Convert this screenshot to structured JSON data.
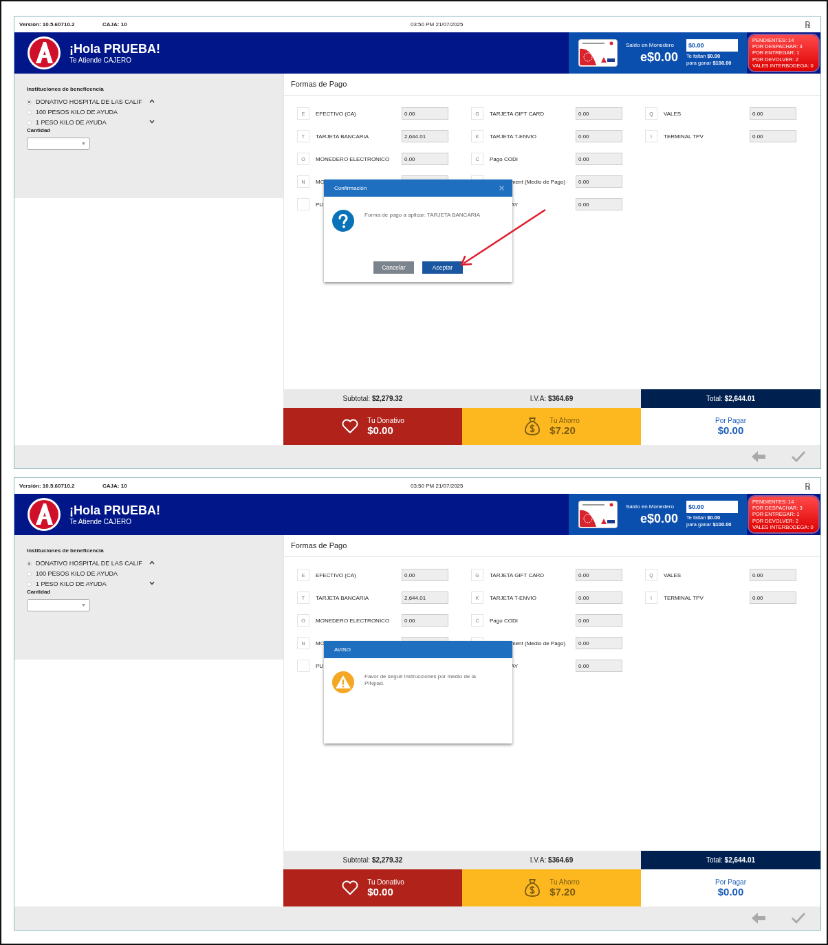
{
  "screens": [
    {
      "top_bar": {
        "version_label": "Versión:",
        "version": "10.5.60710.2",
        "register_label": "CAJA:",
        "register": "10",
        "datetime": "03:50 PM 21/07/2025",
        "rx_symbol": "℞"
      },
      "header": {
        "greeting": "¡Hola PRUEBA!",
        "cashier": "Te Atiende CAJERO",
        "wallet_label": "Saldo en Monedero",
        "wallet_balance": "e$0.00",
        "wallet_input": "$0.00",
        "missing_line": "Te faltan **$0.00**",
        "goal_line": "para ganar **$100.00**",
        "pending": [
          "PENDIENTES: 14",
          "POR DESPACHAR: 3",
          "POR ENTREGAR: 1",
          "POR DEVOLVER: 2",
          "VALES INTERBODEGA: 0"
        ]
      },
      "charities": {
        "title": "Instituciones de beneficencia",
        "options": [
          {
            "label": "DONATIVO HOSPITAL DE LAS CALIF",
            "selected": true
          },
          {
            "label": "100 PESOS KILO DE AYUDA",
            "selected": false
          },
          {
            "label": "1 PESO KILO DE AYUDA",
            "selected": false
          }
        ],
        "quantity_label": "Cantidad"
      },
      "payments": {
        "title": "Formas de Pago",
        "columns": [
          [
            {
              "key": "E",
              "label": "EFECTIVO (CA)",
              "value": "0.00",
              "covered_start": false
            },
            {
              "key": "T",
              "label": "TARJETA BANCARIA",
              "value": "2,644.01",
              "covered_start": false
            },
            {
              "key": "O",
              "label": "MONEDERO ELECTRONICO",
              "value": "0.00",
              "covered_start": false
            },
            {
              "key": "N",
              "label": "MO",
              "covered_start": false
            },
            {
              "label": "PU",
              "covered_start": false
            }
          ],
          [
            {
              "key": "G",
              "label": "TARJETA GIFT CARD",
              "value": "0.00",
              "covered_start": false
            },
            {
              "key": "K",
              "label": "TARJETA T-ENVIO",
              "value": "0.00",
              "covered_start": false
            },
            {
              "key": "C",
              "label": "Pago CODI",
              "value": "0.00",
              "covered_start": false
            },
            {
              "label": "ment (Medio de Pago)",
              "value": "0.00",
              "covered_start": true
            },
            {
              "label": "AY",
              "value": "0.00",
              "covered_start": true
            }
          ],
          [
            {
              "key": "Q",
              "label": "VALES",
              "value": "0.00",
              "covered_start": false
            },
            {
              "key": "I",
              "label": "TERMINAL TPV",
              "value": "0.00",
              "covered_start": false
            }
          ]
        ]
      },
      "totals": {
        "subtotal_label": "Subtotal:",
        "subtotal": "$2,279.32",
        "iva_label": "I.V.A:",
        "iva": "$364.69",
        "total_label": "Total:",
        "total": "$2,644.01"
      },
      "tiles": {
        "donation_label": "Tu Donativo",
        "donation": "$0.00",
        "savings_label": "Tu Ahorro",
        "savings": "$7.20",
        "due_label": "Por Pagar",
        "due": "$0.00"
      },
      "dialog": {
        "kind": "confirm",
        "title": "Confirmación",
        "closable": true,
        "message": "Forma de pago a aplicar: TARJETA BANCARIA",
        "buttons": [
          {
            "label": "Cancelar",
            "kind": "secondary"
          },
          {
            "label": "Aceptar",
            "kind": "primary"
          }
        ]
      },
      "annotation_arrow": true
    },
    {
      "top_bar": {
        "version_label": "Versión:",
        "version": "10.5.60710.2",
        "register_label": "CAJA:",
        "register": "10",
        "datetime": "03:50 PM 21/07/2025",
        "rx_symbol": "℞"
      },
      "header": {
        "greeting": "¡Hola PRUEBA!",
        "cashier": "Te Atiende CAJERO",
        "wallet_label": "Saldo en Monedero",
        "wallet_balance": "e$0.00",
        "wallet_input": "$0.00",
        "missing_line": "Te faltan **$0.00**",
        "goal_line": "para ganar **$100.00**",
        "pending": [
          "PENDIENTES: 14",
          "POR DESPACHAR: 3",
          "POR ENTREGAR: 1",
          "POR DEVOLVER: 2",
          "VALES INTERBODEGA: 0"
        ]
      },
      "charities": {
        "title": "Instituciones de beneficencia",
        "options": [
          {
            "label": "DONATIVO HOSPITAL DE LAS CALIF",
            "selected": true
          },
          {
            "label": "100 PESOS KILO DE AYUDA",
            "selected": false
          },
          {
            "label": "1 PESO KILO DE AYUDA",
            "selected": false
          }
        ],
        "quantity_label": "Cantidad"
      },
      "payments": {
        "title": "Formas de Pago",
        "columns": [
          [
            {
              "key": "E",
              "label": "EFECTIVO (CA)",
              "value": "0.00",
              "covered_start": false
            },
            {
              "key": "T",
              "label": "TARJETA BANCARIA",
              "value": "2,644.01",
              "covered_start": false
            },
            {
              "key": "O",
              "label": "MONEDERO ELECTRONICO",
              "value": "0.00",
              "covered_start": false
            },
            {
              "key": "N",
              "label": "MO",
              "covered_start": false
            },
            {
              "label": "PU",
              "covered_start": false
            }
          ],
          [
            {
              "key": "G",
              "label": "TARJETA GIFT CARD",
              "value": "0.00",
              "covered_start": false
            },
            {
              "key": "K",
              "label": "TARJETA T-ENVIO",
              "value": "0.00",
              "covered_start": false
            },
            {
              "key": "C",
              "label": "Pago CODI",
              "value": "0.00",
              "covered_start": false
            },
            {
              "label": "ment (Medio de Pago)",
              "value": "0.00",
              "covered_start": true
            },
            {
              "label": "AY",
              "value": "0.00",
              "covered_start": true
            }
          ],
          [
            {
              "key": "Q",
              "label": "VALES",
              "value": "0.00",
              "covered_start": false
            },
            {
              "key": "I",
              "label": "TERMINAL TPV",
              "value": "0.00",
              "covered_start": false
            }
          ]
        ]
      },
      "totals": {
        "subtotal_label": "Subtotal:",
        "subtotal": "$2,279.32",
        "iva_label": "I.V.A:",
        "iva": "$364.69",
        "total_label": "Total:",
        "total": "$2,644.01"
      },
      "tiles": {
        "donation_label": "Tu Donativo",
        "donation": "$0.00",
        "savings_label": "Tu Ahorro",
        "savings": "$7.20",
        "due_label": "Por Pagar",
        "due": "$0.00"
      },
      "dialog": {
        "kind": "warning",
        "title": "AVISO",
        "closable": false,
        "message": "Favor de seguir instrucciones por medio de la PINpad."
      },
      "annotation_arrow": false
    }
  ]
}
